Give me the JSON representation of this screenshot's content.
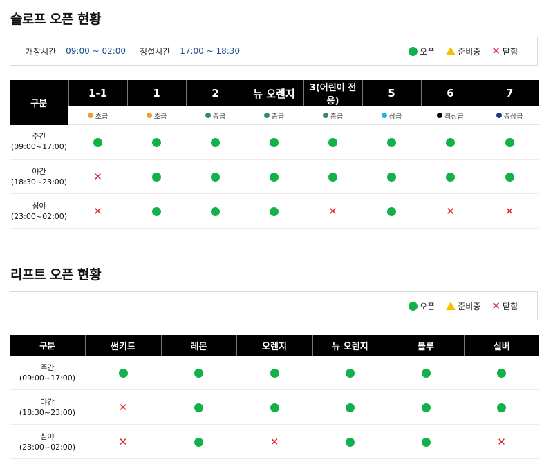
{
  "slope": {
    "title": "슬로프 오픈 현황",
    "hours": [
      {
        "label": "개장시간",
        "value": "09:00 ~ 02:00"
      },
      {
        "label": "정설시간",
        "value": "17:00 ~ 18:30"
      }
    ],
    "legend": {
      "open": "오픈",
      "ready": "준비중",
      "closed": "닫힘"
    },
    "header_label": "구분",
    "columns": [
      {
        "name": "1-1",
        "level": "초급",
        "level_color": "#f39a3a"
      },
      {
        "name": "1",
        "level": "초급",
        "level_color": "#f39a3a"
      },
      {
        "name": "2",
        "level": "중급",
        "level_color": "#3b8a5e"
      },
      {
        "name": "뉴 오렌지",
        "level": "중급",
        "level_color": "#3b8a5e"
      },
      {
        "name": "3(어린이 전용)",
        "level": "중급",
        "level_color": "#3b8a5e"
      },
      {
        "name": "5",
        "level": "상급",
        "level_color": "#1fb5e8"
      },
      {
        "name": "6",
        "level": "최상급",
        "level_color": "#000000"
      },
      {
        "name": "7",
        "level": "중상급",
        "level_color": "#1a3d7c"
      }
    ],
    "rows": [
      {
        "name": "주간",
        "time": "(09:00~17:00)",
        "status": [
          "open",
          "open",
          "open",
          "open",
          "open",
          "open",
          "open",
          "open"
        ]
      },
      {
        "name": "야간",
        "time": "(18:30~23:00)",
        "status": [
          "closed",
          "open",
          "open",
          "open",
          "open",
          "open",
          "open",
          "open"
        ]
      },
      {
        "name": "심야",
        "time": "(23:00~02:00)",
        "status": [
          "closed",
          "open",
          "open",
          "open",
          "closed",
          "open",
          "closed",
          "closed"
        ]
      }
    ]
  },
  "lift": {
    "title": "리프트 오픈 현황",
    "legend": {
      "open": "오픈",
      "ready": "준비중",
      "closed": "닫힘"
    },
    "header_label": "구분",
    "columns": [
      "썬키드",
      "레몬",
      "오렌지",
      "뉴 오렌지",
      "블루",
      "실버"
    ],
    "rows": [
      {
        "name": "주간",
        "time": "(09:00~17:00)",
        "status": [
          "open",
          "open",
          "open",
          "open",
          "open",
          "open"
        ]
      },
      {
        "name": "야간",
        "time": "(18:30~23:00)",
        "status": [
          "closed",
          "open",
          "open",
          "open",
          "open",
          "open"
        ]
      },
      {
        "name": "심야",
        "time": "(23:00~02:00)",
        "status": [
          "closed",
          "open",
          "closed",
          "open",
          "open",
          "closed"
        ]
      }
    ]
  },
  "colors": {
    "open": "#14b04b",
    "ready": "#f3c000",
    "closed": "#e0212b"
  },
  "icons": {
    "open": "green-circle-icon",
    "ready": "yellow-triangle-icon",
    "closed": "red-x-icon"
  }
}
